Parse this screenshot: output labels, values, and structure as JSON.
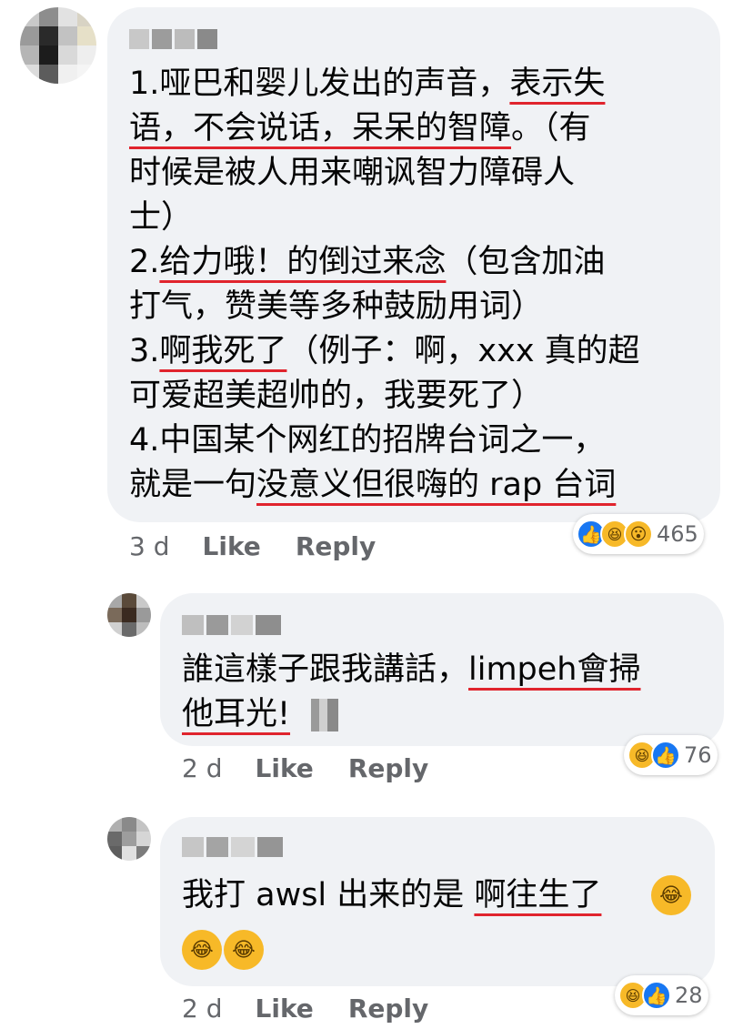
{
  "comments": [
    {
      "lines": [
        [
          {
            "t": "1.哑巴和婴儿发出的声音，"
          },
          {
            "t": "表示失",
            "u": true
          }
        ],
        [
          {
            "t": "语，不会说话，呆呆的智障",
            "u": true
          },
          {
            "t": "。（有"
          }
        ],
        [
          {
            "t": "时候是被人用来嘲讽智力障碍人"
          }
        ],
        [
          {
            "t": "士）"
          }
        ],
        [
          {
            "t": "2."
          },
          {
            "t": "给力哦！的倒过来念",
            "u": true
          },
          {
            "t": "（包含加油"
          }
        ],
        [
          {
            "t": "打气，赞美等多种鼓励用词）"
          }
        ],
        [
          {
            "t": "3."
          },
          {
            "t": "啊我死了",
            "u": true
          },
          {
            "t": "（例子：啊，xxx 真的超"
          }
        ],
        [
          {
            "t": "可爱超美超帅的，我要死了）"
          }
        ],
        [
          {
            "t": "4.中国某个网红的招牌台词之一，"
          }
        ],
        [
          {
            "t": "就是一句"
          },
          {
            "t": "没意义但很嗨的 rap 台词",
            "u": true
          }
        ]
      ],
      "time": "3 d",
      "like": "Like",
      "reply": "Reply",
      "reactions": [
        "like",
        "haha",
        "wow"
      ],
      "count": "465"
    },
    {
      "lines": [
        [
          {
            "t": "誰這樣子跟我講話，"
          },
          {
            "t": "limpeh會掃",
            "u": true
          }
        ],
        [
          {
            "t": "他耳光!",
            "u": true
          }
        ]
      ],
      "time": "2 d",
      "like": "Like",
      "reply": "Reply",
      "reactions": [
        "haha",
        "like"
      ],
      "count": "76"
    },
    {
      "lines": [
        [
          {
            "t": "我打 awsl 出来的是 "
          },
          {
            "t": "啊往生了",
            "u": true
          }
        ]
      ],
      "time": "2 d",
      "like": "Like",
      "reply": "Reply",
      "reactions": [
        "haha",
        "like"
      ],
      "count": "28"
    }
  ],
  "icons": {
    "like": "👍",
    "haha": "😆",
    "wow": "😮",
    "cry-laugh": "😂"
  },
  "colors": {
    "bubble": "#f0f2f5",
    "underline": "#e0242d",
    "meta": "#65676b",
    "like_blue": "#1877f2",
    "emoji_yellow": "#f7b928"
  }
}
